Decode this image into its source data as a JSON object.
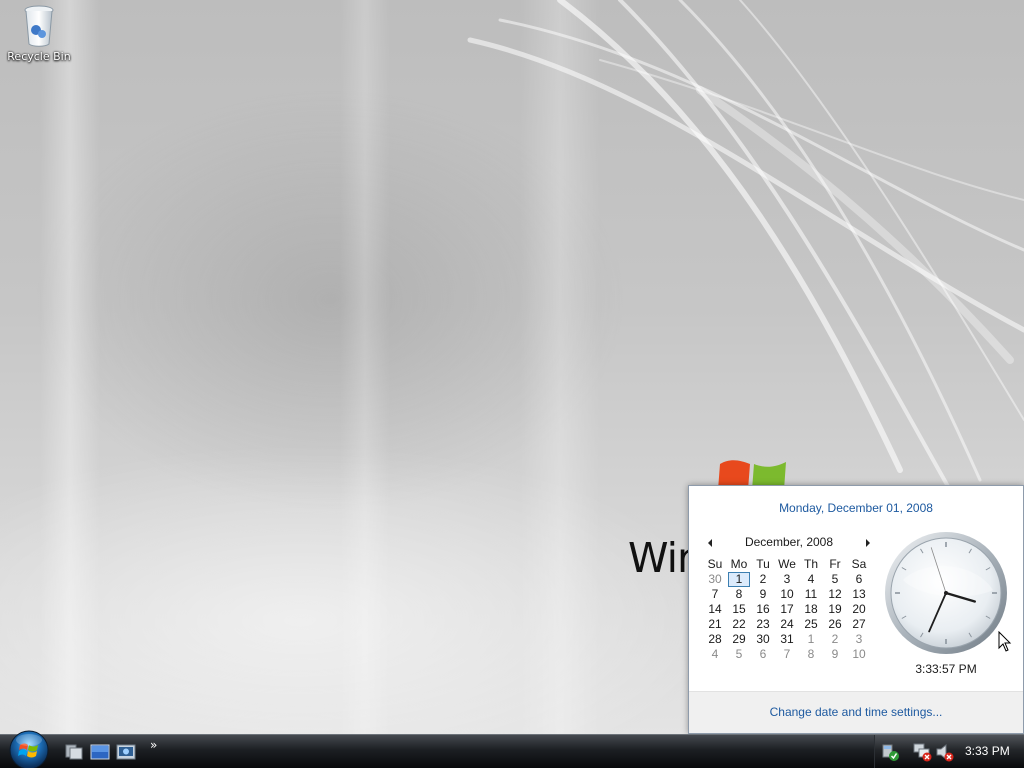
{
  "desktop": {
    "icons": [
      {
        "label": "Recycle Bin",
        "icon": "recycle-bin-icon"
      }
    ],
    "wallpaper_brand": "Wir"
  },
  "flyout": {
    "long_date": "Monday, December 01, 2008",
    "calendar": {
      "month_label": "December, 2008",
      "days_of_week": [
        "Su",
        "Mo",
        "Tu",
        "We",
        "Th",
        "Fr",
        "Sa"
      ],
      "weeks": [
        [
          {
            "d": "30",
            "other": true
          },
          {
            "d": "1",
            "today": true
          },
          {
            "d": "2"
          },
          {
            "d": "3"
          },
          {
            "d": "4"
          },
          {
            "d": "5"
          },
          {
            "d": "6"
          }
        ],
        [
          {
            "d": "7"
          },
          {
            "d": "8"
          },
          {
            "d": "9"
          },
          {
            "d": "10"
          },
          {
            "d": "11"
          },
          {
            "d": "12"
          },
          {
            "d": "13"
          }
        ],
        [
          {
            "d": "14"
          },
          {
            "d": "15"
          },
          {
            "d": "16"
          },
          {
            "d": "17"
          },
          {
            "d": "18"
          },
          {
            "d": "19"
          },
          {
            "d": "20"
          }
        ],
        [
          {
            "d": "21"
          },
          {
            "d": "22"
          },
          {
            "d": "23"
          },
          {
            "d": "24"
          },
          {
            "d": "25"
          },
          {
            "d": "26"
          },
          {
            "d": "27"
          }
        ],
        [
          {
            "d": "28"
          },
          {
            "d": "29"
          },
          {
            "d": "30"
          },
          {
            "d": "31"
          },
          {
            "d": "1",
            "other": true
          },
          {
            "d": "2",
            "other": true
          },
          {
            "d": "3",
            "other": true
          }
        ],
        [
          {
            "d": "4",
            "other": true
          },
          {
            "d": "5",
            "other": true
          },
          {
            "d": "6",
            "other": true
          },
          {
            "d": "7",
            "other": true
          },
          {
            "d": "8",
            "other": true
          },
          {
            "d": "9",
            "other": true
          },
          {
            "d": "10",
            "other": true
          }
        ]
      ]
    },
    "clock": {
      "hour": 3,
      "minute": 33,
      "second": 57
    },
    "digital_time": "3:33:57 PM",
    "settings_link": "Change date and time settings..."
  },
  "taskbar": {
    "start_icon": "windows-start-orb-icon",
    "quick_launch": [
      {
        "icon": "switch-windows-icon"
      },
      {
        "icon": "show-desktop-icon"
      },
      {
        "icon": "media-player-icon"
      }
    ],
    "overflow_chevron": "»",
    "tray_icons": [
      "security-center-icon",
      "network-disconnected-icon",
      "volume-muted-icon"
    ],
    "clock_text": "3:33 PM"
  },
  "colors": {
    "link_blue": "#1e5aa0",
    "today_border": "#3c7fb1"
  }
}
